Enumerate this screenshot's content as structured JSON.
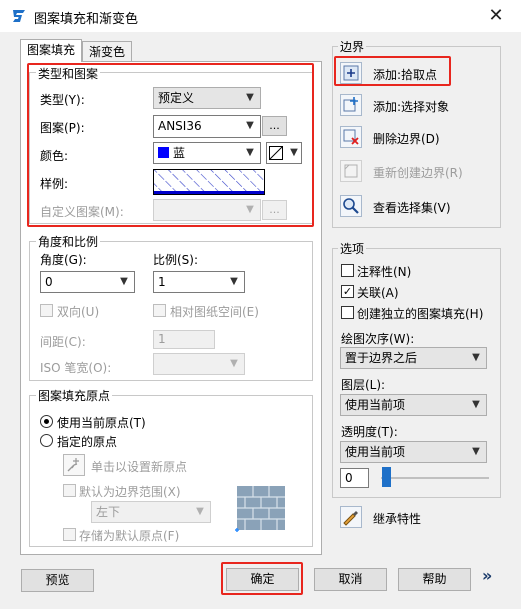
{
  "window": {
    "title": "图案填充和渐变色",
    "close_glyph": "✕"
  },
  "tabs": [
    {
      "label": "图案填充"
    },
    {
      "label": "渐变色"
    }
  ],
  "type_pattern": {
    "title": "类型和图案",
    "type_label": "类型(Y):",
    "type_value": "预定义",
    "pattern_label": "图案(P):",
    "pattern_value": "ANSI36",
    "color_label": "颜色:",
    "color_value": "蓝",
    "color_hex": "#0000ff",
    "swatch_label": "样例:",
    "custom_label": "自定义图案(M):",
    "dots_label": "..."
  },
  "angle_scale": {
    "title": "角度和比例",
    "angle_label": "角度(G):",
    "angle_value": "0",
    "scale_label": "比例(S):",
    "scale_value": "1",
    "double_label": "双向(U)",
    "relative_label": "相对图纸空间(E)",
    "spacing_label": "间距(C):",
    "spacing_value": "1",
    "iso_label": "ISO 笔宽(O):"
  },
  "origin": {
    "title": "图案填充原点",
    "use_current_label": "使用当前原点(T)",
    "specified_label": "指定的原点",
    "click_set_label": "单击以设置新原点",
    "default_extent_label": "默认为边界范围(X)",
    "extent_value": "左下",
    "store_default_label": "存储为默认原点(F)"
  },
  "boundary": {
    "title": "边界",
    "add_pick_label": "添加:拾取点",
    "add_select_label": "添加:选择对象",
    "remove_label": "删除边界(D)",
    "recreate_label": "重新创建边界(R)",
    "view_selection_label": "查看选择集(V)"
  },
  "options": {
    "title": "选项",
    "annotative_label": "注释性(N)",
    "associative_label": "关联(A)",
    "separate_label": "创建独立的图案填充(H)",
    "draw_order_label": "绘图次序(W):",
    "draw_order_value": "置于边界之后",
    "layer_label": "图层(L):",
    "layer_value": "使用当前项",
    "transparency_label": "透明度(T):",
    "transparency_value": "使用当前项",
    "transparency_amount": "0",
    "inherit_label": "继承特性"
  },
  "buttons": {
    "preview": "预览",
    "ok": "确定",
    "cancel": "取消",
    "help": "帮助",
    "more": "»"
  },
  "colors": {
    "highlight_red": "#e8261e",
    "accent_blue": "#1e70c8",
    "hatch_blue": "#3440c8"
  }
}
